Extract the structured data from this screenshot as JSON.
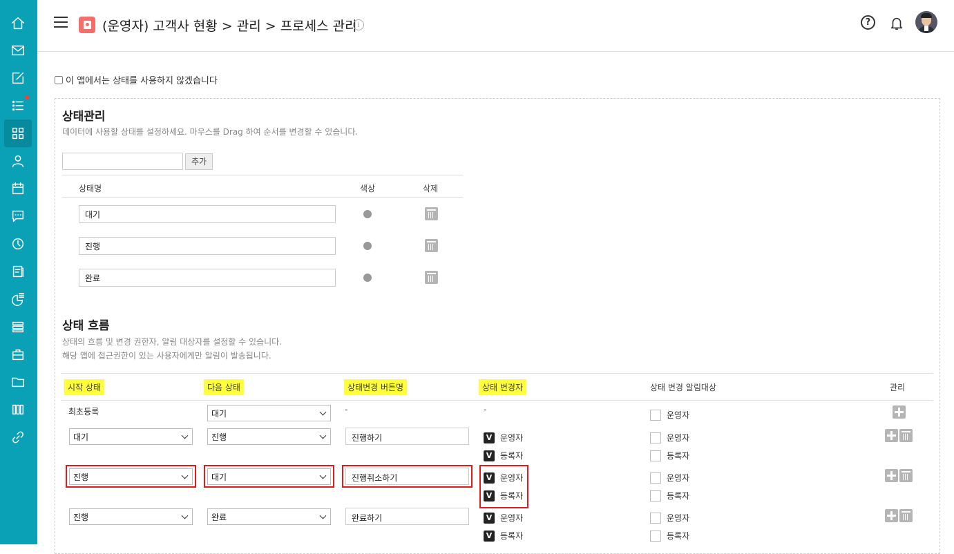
{
  "header": {
    "title": "(운영자) 고객사 현황 > 관리 > 프로세스 관리",
    "info_glyph": "i",
    "help_glyph": "?"
  },
  "sidebar": {
    "items": [
      "home-icon",
      "mail-icon",
      "edit-icon",
      "list-icon",
      "grid-icon",
      "user-icon",
      "calendar-icon",
      "chat-icon",
      "clock-icon",
      "board-icon",
      "chart-icon",
      "stack-icon",
      "briefcase-icon",
      "folder-icon",
      "library-icon",
      "link-icon"
    ]
  },
  "nostate_label": "이 앱에서는 상태를 사용하지 않겠습니다",
  "state_mgmt": {
    "title": "상태관리",
    "desc": "데이터에 사용할 상태를 설정하세요. 마우스를 Drag 하여 순서를 변경할 수 있습니다.",
    "add_button": "추가",
    "col_name": "상태명",
    "col_color": "색상",
    "col_delete": "삭제",
    "states": [
      {
        "name": "대기",
        "color": "#999999"
      },
      {
        "name": "진행",
        "color": "#999999"
      },
      {
        "name": "완료",
        "color": "#999999"
      }
    ]
  },
  "state_flow": {
    "title": "상태 흐름",
    "desc1": "상태의 흐름 및 변경 권한자, 알림 대상자를 설정할 수 있습니다.",
    "desc2": "해당 앱에 접근권한이 있는 사용자에게만 알림이 발송됩니다.",
    "col_start": "시작 상태",
    "col_next": "다음 상태",
    "col_button": "상태변경 버튼명",
    "col_changer": "상태 변경자",
    "col_notify": "상태 변경 알림대상",
    "col_manage": "관리",
    "first_start": "최초등록",
    "first_next": "대기",
    "dash": "-",
    "rows": [
      {
        "start": "대기",
        "next": "진행",
        "button": "진행하기"
      },
      {
        "start": "진행",
        "next": "대기",
        "button": "진행취소하기"
      },
      {
        "start": "진행",
        "next": "완료",
        "button": "완료하기"
      }
    ],
    "check_v": "V",
    "role_operator": "운영자",
    "role_registrant": "등록자"
  }
}
